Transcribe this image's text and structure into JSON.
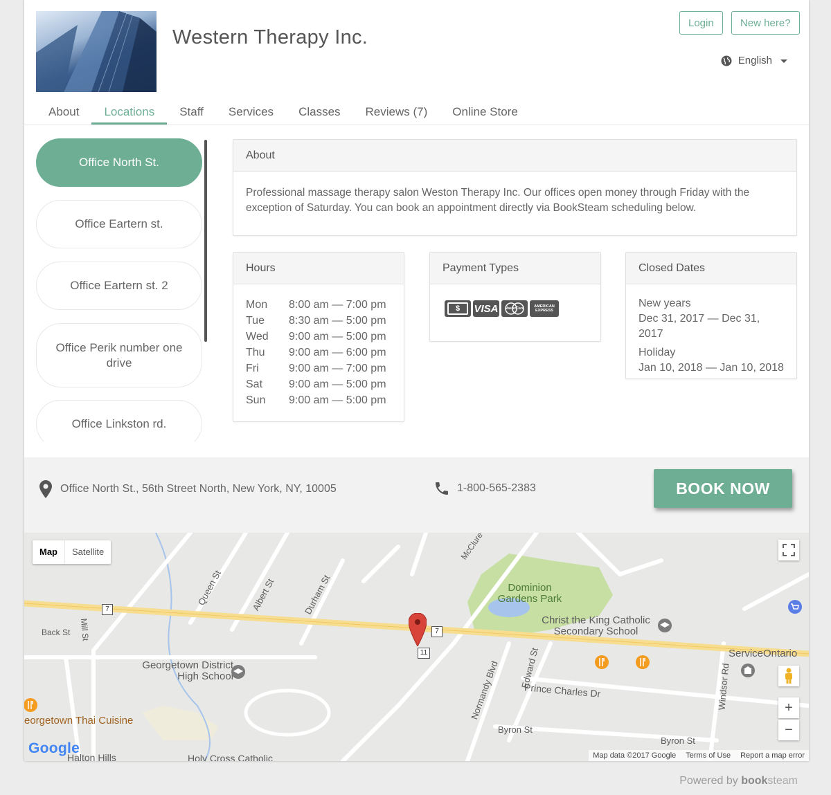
{
  "header": {
    "title": "Western Therapy Inc.",
    "login_label": "Login",
    "new_here_label": "New here?",
    "language": "English"
  },
  "nav": {
    "tabs": [
      {
        "label": "About"
      },
      {
        "label": "Locations"
      },
      {
        "label": "Staff"
      },
      {
        "label": "Services"
      },
      {
        "label": "Classes"
      },
      {
        "label": "Reviews (7)"
      },
      {
        "label": "Online Store"
      }
    ],
    "active": "Locations"
  },
  "locations": [
    {
      "label": "Office North St."
    },
    {
      "label": "Office Eartern st."
    },
    {
      "label": "Office Eartern st. 2"
    },
    {
      "label": "Office Perik number one drive"
    },
    {
      "label": "Office Linkston rd."
    }
  ],
  "about": {
    "heading": "About",
    "text": "Professional massage therapy salon Weston Therapy Inc. Our offices open money through Friday with the exception of Saturday. You can book an appointment directly via BookSteam scheduling below."
  },
  "hours": {
    "heading": "Hours",
    "rows": [
      {
        "day": "Mon",
        "time": "8:00 am — 7:00 pm"
      },
      {
        "day": "Tue",
        "time": "8:30 am — 5:00 pm"
      },
      {
        "day": "Wed",
        "time": "9:00 am — 5:00 pm"
      },
      {
        "day": "Thu",
        "time": "9:00 am — 6:00 pm"
      },
      {
        "day": "Fri",
        "time": "9:00 am — 7:00 pm"
      },
      {
        "day": "Sat",
        "time": "9:00 am — 5:00 pm"
      },
      {
        "day": "Sun",
        "time": "9:00 am — 5:00 pm"
      }
    ]
  },
  "payment": {
    "heading": "Payment Types",
    "cards": [
      {
        "name": "cash-icon",
        "label": "$"
      },
      {
        "name": "visa-icon",
        "label": "VISA"
      },
      {
        "name": "mastercard-icon",
        "label": "MasterCard"
      },
      {
        "name": "amex-icon",
        "label": "AMERICAN EXPRESS"
      }
    ]
  },
  "closed": {
    "heading": "Closed Dates",
    "items": [
      {
        "name": "New years",
        "range": "Dec 31, 2017 — Dec 31, 2017"
      },
      {
        "name": "Holiday",
        "range": "Jan 10, 2018 — Jan 10, 2018"
      }
    ]
  },
  "contact": {
    "address": "Office North St., 56th Street North, New York, NY, 10005",
    "phone": "1-800-565-2383",
    "book_label": "BOOK NOW"
  },
  "map": {
    "type_map": "Map",
    "type_satellite": "Satellite",
    "labels": {
      "dominion": "Dominion Gardens Park",
      "christ": "Christ the King Catholic Secondary School",
      "georgetown_hs": "Georgetown District High School",
      "thai": "eorgetown Thai Cuisine",
      "service": "ServiceOntario",
      "prince": "Prince Charles Dr",
      "byron1": "Byron St",
      "byron2": "Byron St",
      "queen": "Queen St",
      "albert": "Albert St",
      "durham": "Durham St",
      "mcclure": "McClure",
      "normandy": "Normandy Blvd",
      "edward": "Edward St",
      "windsor": "Windsor Rd",
      "mill": "Mill St",
      "back": "Back St",
      "halton": "Halton Hills",
      "holycross": "Holy Cross Catholic",
      "route7": "7",
      "route7b": "7",
      "route11": "11"
    },
    "google": "Google",
    "attribution": {
      "data": "Map data ©2017 Google",
      "terms": "Terms of Use",
      "report": "Report a map error"
    }
  },
  "footer": {
    "powered": "Powered by",
    "brand_bold": "book",
    "brand_light": "steam"
  },
  "colors": {
    "accent": "#6dae95"
  }
}
